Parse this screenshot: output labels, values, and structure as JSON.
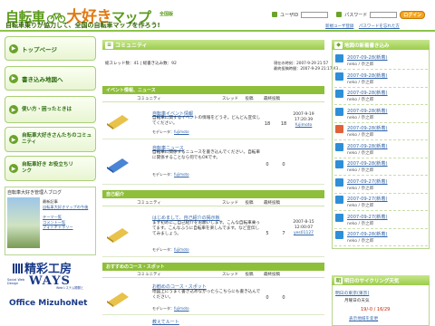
{
  "header": {
    "title_a": "自転車",
    "title_b": "大好き",
    "title_c": "マップ",
    "edition": "全国版",
    "tagline": "自転車乗りが協力して、全国の自転車マップを作ろう!",
    "login": {
      "user_label": "ユーザID",
      "pass_label": "パスワード",
      "button_label": "ログイン",
      "links": [
        "新規ユーザ登録",
        "パスワードを忘れた方"
      ]
    }
  },
  "nav": {
    "items": [
      {
        "label": "トップページ"
      },
      {
        "label": "書き込み地図へ"
      },
      {
        "label": "使い方・困ったときは"
      },
      {
        "label": "自転車大好きさんたちのコミュニティ"
      },
      {
        "label": "自転車好き お役立ちリンク"
      }
    ]
  },
  "blog": {
    "title": "自転車大好き管理人ブログ",
    "text_1": "最新記事",
    "text_2": "自転車大好きマップの今後",
    "text_3": "テーマ一覧",
    "text_4": "コメント一覧",
    "text_5": "フォトギャラリー"
  },
  "sponsors": {
    "s1": "精彩工房",
    "s2_main": "WAYS",
    "s2_sub": "Social Web Design",
    "s2_note": "Webシステム開発と",
    "s3": "Office MizuhoNet"
  },
  "community": {
    "heading": "コミュニティ",
    "stats": "総スレッド数：41 | 総書き込み数：92",
    "current_time": "現在の時刻：2007-9-29 21:57",
    "last_post": "最終投稿時間：2007-9-29 21:17:43",
    "col_headers": [
      "コミュニティ",
      "スレッド",
      "投稿",
      "最終投稿"
    ],
    "sections": [
      {
        "name": "イベント情報、ニュース",
        "rows": [
          {
            "title": "自転車イベント情報",
            "desc": "自転車に関するイベントの情報をどうぞ。どんどん宣伝してください。",
            "moderator_label": "モデレータ",
            "moderator": "fujimoto",
            "threads": "18",
            "posts": "18",
            "last_date": "2007-9-19",
            "last_time": "17:20:39",
            "last_user": "fujimoto"
          },
          {
            "title": "自転車ニュース",
            "desc": "自転車に関係するニュースを書き込んでください。自転車に関係することなら何でもOKです。",
            "moderator_label": "モデレータ",
            "moderator": "fujimoto",
            "threads": "0",
            "posts": "0",
            "last_date": "",
            "last_time": "",
            "last_user": ""
          }
        ]
      },
      {
        "name": "自己紹介",
        "rows": [
          {
            "title": "はじめまして、自己紹介の掲示板",
            "desc": "まず初めにご自己紹介をお願いします。こんな自転車乗ってます。こんなふうに自転車を楽しんでます。など宣伝してみましょう。",
            "moderator_label": "モデレータ",
            "moderator": "fujimoto",
            "threads": "5",
            "posts": "7",
            "last_date": "2007-8-15",
            "last_time": "12:00:07",
            "last_user": "yes01127"
          }
        ]
      },
      {
        "name": "おすすめのコース・スポット",
        "rows": [
          {
            "title": "お勧めのコース・スポット",
            "desc": "地図上にうまく書き込めなかったらこちらにも書き込んでください。",
            "moderator_label": "モデレータ",
            "moderator": "fujimoto",
            "threads": "0",
            "posts": "0",
            "last_date": "",
            "last_time": "",
            "last_user": ""
          },
          {
            "title": "教えてルート",
            "desc": "",
            "moderator_label": "",
            "moderator": "",
            "threads": "",
            "posts": "",
            "last_date": "",
            "last_time": "",
            "last_user": ""
          }
        ]
      }
    ]
  },
  "new_posts": {
    "heading": "地図の新着書き込み",
    "items": [
      {
        "date": "2007-09-28(新着)",
        "user": "neko / 奈之郎",
        "color": "#2e8fd8"
      },
      {
        "date": "2007-09-28(新着)",
        "user": "neko / 奈之郎",
        "color": "#2e8fd8"
      },
      {
        "date": "2007-09-28(新着)",
        "user": "neko / 奈之郎",
        "color": "#2e8fd8"
      },
      {
        "date": "2007-09-28(新着)",
        "user": "neko / 奈之郎",
        "color": "#2e8fd8"
      },
      {
        "date": "2007-09-28(新着)",
        "user": "neko / 奈之郎",
        "color": "#e0623a"
      },
      {
        "date": "2007-09-28(新着)",
        "user": "neko / 奈之郎",
        "color": "#2e8fd8"
      },
      {
        "date": "2007-09-28(新着)",
        "user": "neko / 奈之郎",
        "color": "#2e8fd8"
      },
      {
        "date": "2007-09-27(新着)",
        "user": "neko / 奈之郎",
        "color": "#2e8fd8"
      },
      {
        "date": "2007-09-27(新着)",
        "user": "neko / 奈之郎",
        "color": "#2e8fd8"
      },
      {
        "date": "2007-09-27(新着)",
        "user": "neko / 奈之郎",
        "color": "#2e8fd8"
      },
      {
        "date": "2007-09-28(新着)",
        "user": "neko / 奈之郎",
        "color": "#2e8fd8"
      }
    ]
  },
  "cycle": {
    "heading": "明日のサイクリング天気",
    "city": "明日の東京(東京)",
    "day": "月曜日の天気",
    "temp": "19/-0 / 16/29",
    "link": "表示地域を変更"
  },
  "colors": {
    "accent": "#8ebf3a",
    "brand": "#5a9a1a",
    "link": "#3366aa",
    "orange": "#e07a10"
  }
}
